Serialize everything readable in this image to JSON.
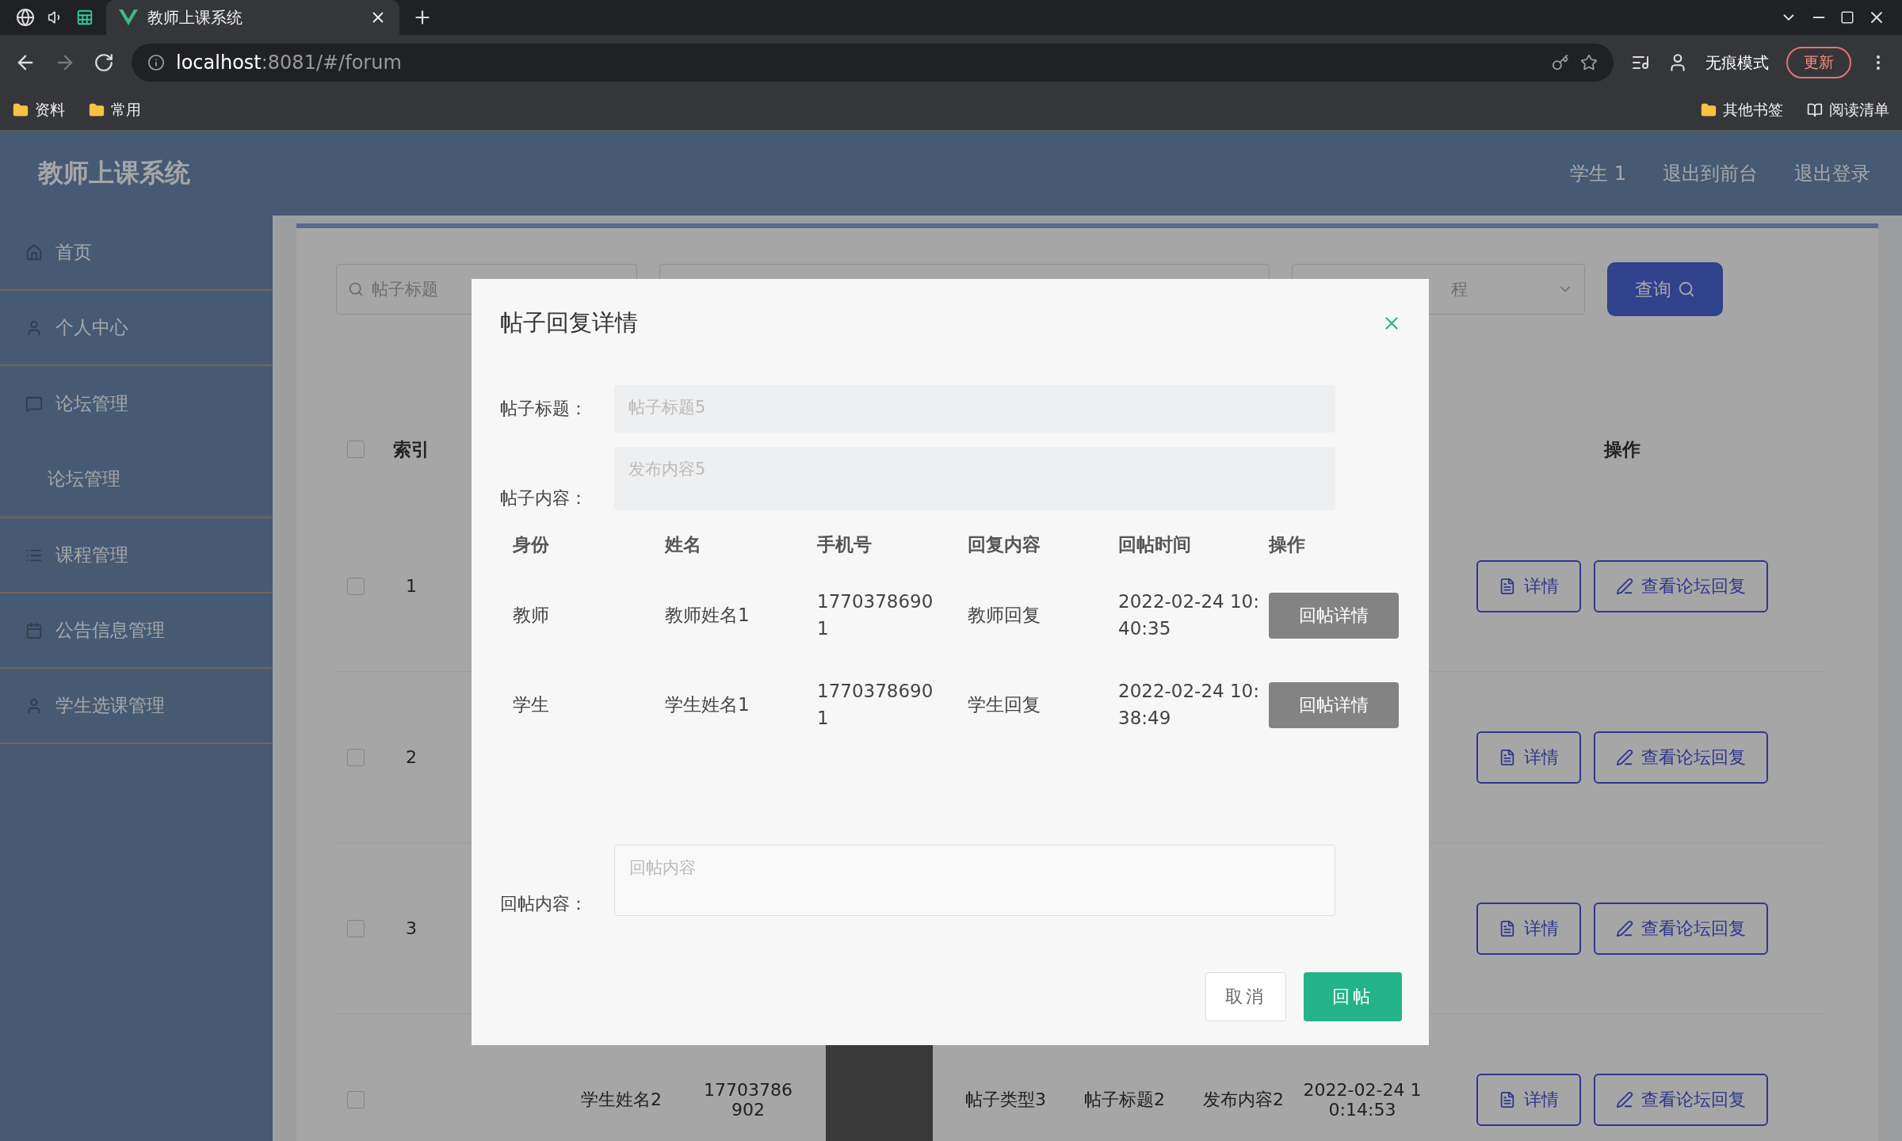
{
  "browser": {
    "tab": {
      "title": "教师上课系统"
    },
    "url_host": "localhost",
    "url_rest": ":8081/#/forum",
    "profile": "无痕模式",
    "update_button": "更新",
    "bookmarks": [
      {
        "label": "资料",
        "kind": "folder"
      },
      {
        "label": "常用",
        "kind": "folder"
      }
    ],
    "bookmarks_right": [
      {
        "label": "其他书签",
        "kind": "folder"
      },
      {
        "label": "阅读清单",
        "kind": "list"
      }
    ]
  },
  "header": {
    "title": "教师上课系统",
    "user": "学生 1",
    "links": [
      "退出到前台",
      "退出登录"
    ]
  },
  "sidebar": {
    "items": [
      {
        "label": "首页"
      },
      {
        "label": "个人中心"
      },
      {
        "label": "论坛管理",
        "children": [
          {
            "label": "论坛管理"
          }
        ]
      },
      {
        "label": "课程管理"
      },
      {
        "label": "公告信息管理"
      },
      {
        "label": "学生选课管理"
      }
    ]
  },
  "search": {
    "title_placeholder": "帖子标题",
    "select_value": "程",
    "query_button": "查询"
  },
  "table": {
    "index_header": "索引",
    "actions_header": "操作",
    "all_checked": false,
    "rows": [
      {
        "index": "1",
        "checked": false,
        "actions": [
          "详情",
          "查看论坛回复"
        ]
      },
      {
        "index": "2",
        "checked": false,
        "actions": [
          "详情",
          "查看论坛回复"
        ]
      },
      {
        "index": "3",
        "checked": false,
        "actions": [
          "详情",
          "查看论坛回复"
        ]
      },
      {
        "checked": false,
        "name": "学生姓名2",
        "phone": "17703786902",
        "type": "帖子类型3",
        "title": "帖子标题2",
        "content": "发布内容2",
        "time": "2022-02-24 10:14:53",
        "actions": [
          "详情",
          "查看论坛回复"
        ]
      }
    ]
  },
  "dialog": {
    "title": "帖子回复详情",
    "fields": [
      {
        "label": "帖子标题：",
        "value": "帖子标题5",
        "kind": "input"
      },
      {
        "label": "帖子内容：",
        "value": "发布内容5",
        "kind": "textarea"
      }
    ],
    "replies": {
      "columns": [
        "身份",
        "姓名",
        "手机号",
        "回复内容",
        "回帖时间",
        "操作"
      ],
      "rows": [
        {
          "role": "教师",
          "name": "教师姓名1",
          "phone": "17703786901",
          "content": "教师回复",
          "time": "2022-02-24 10:40:35",
          "action": "回帖详情"
        },
        {
          "role": "学生",
          "name": "学生姓名1",
          "phone": "17703786901",
          "content": "学生回复",
          "time": "2022-02-24 10:38:49",
          "action": "回帖详情"
        }
      ]
    },
    "reply_field": {
      "label": "回帖内容：",
      "placeholder": "回帖内容"
    },
    "buttons": [
      {
        "label": "取消",
        "kind": "secondary"
      },
      {
        "label": "回帖",
        "kind": "primary"
      }
    ]
  }
}
